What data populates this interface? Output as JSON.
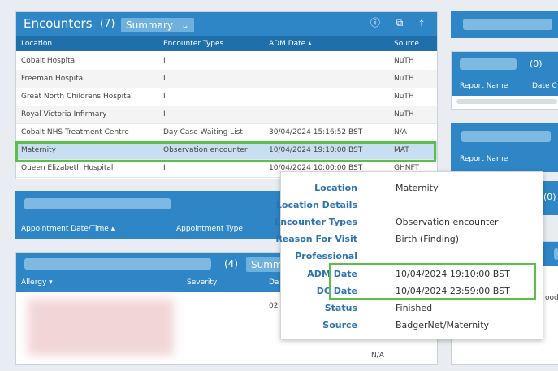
{
  "encounters": {
    "title": "Encounters",
    "count": "(7)",
    "summary_label": "Summary",
    "columns": [
      "Location",
      "Encounter Types",
      "ADM Date ▴",
      "Source"
    ],
    "rows": [
      {
        "location": "Cobalt Hospital",
        "type": "I",
        "adm": "",
        "source": "NuTH"
      },
      {
        "location": "Freeman Hospital",
        "type": "I",
        "adm": "",
        "source": "NuTH"
      },
      {
        "location": "Great North Childrens Hospital",
        "type": "I",
        "adm": "",
        "source": "NuTH"
      },
      {
        "location": "Royal Victoria Infirmary",
        "type": "I",
        "adm": "",
        "source": "NuTH"
      },
      {
        "location": "Cobalt NHS Treatment Centre",
        "type": "Day Case Waiting List",
        "adm": "30/04/2024 15:16:52 BST",
        "source": "N/A"
      },
      {
        "location": "Maternity",
        "type": "Observation encounter",
        "adm": "10/04/2024 19:10:00 BST",
        "source": "MAT"
      },
      {
        "location": "Queen Elizabeth Hospital",
        "type": "I",
        "adm": "10/04/2024 10:00:00 BST",
        "source": "GHNFT"
      }
    ]
  },
  "appointments": {
    "col1": "Appointment Date/Time ▴",
    "col2": "Appointment Type"
  },
  "allergies": {
    "count": "(4)",
    "summary_label": "Summ",
    "col1": "Allergy ▾",
    "col2": "Severity",
    "col3": "Da",
    "row_date_partial": "02",
    "na": "N/A"
  },
  "right_panels": {
    "count1": "(0)",
    "report_name": "Report Name",
    "date_partial": "Date C",
    "report_name2": "Report Name",
    "count2": "(0)",
    "partial_text": "ood"
  },
  "popup": {
    "fields": [
      {
        "label": "Location",
        "value": "Maternity"
      },
      {
        "label": "Location Details",
        "value": ""
      },
      {
        "label": "Encounter Types",
        "value": "Observation encounter"
      },
      {
        "label": "Reason For Visit",
        "value": "Birth (Finding)"
      },
      {
        "label": "Professional",
        "value": ""
      },
      {
        "label": "ADM Date",
        "value": "10/04/2024 19:10:00 BST"
      },
      {
        "label": "DC Date",
        "value": "10/04/2024 23:59:00 BST"
      },
      {
        "label": "Status",
        "value": "Finished"
      },
      {
        "label": "Source",
        "value": "BadgerNet/Maternity"
      }
    ]
  },
  "colors": {
    "header": "#2f86c6",
    "colheader": "#1f6faa",
    "highlight": "#5cbf4b"
  }
}
